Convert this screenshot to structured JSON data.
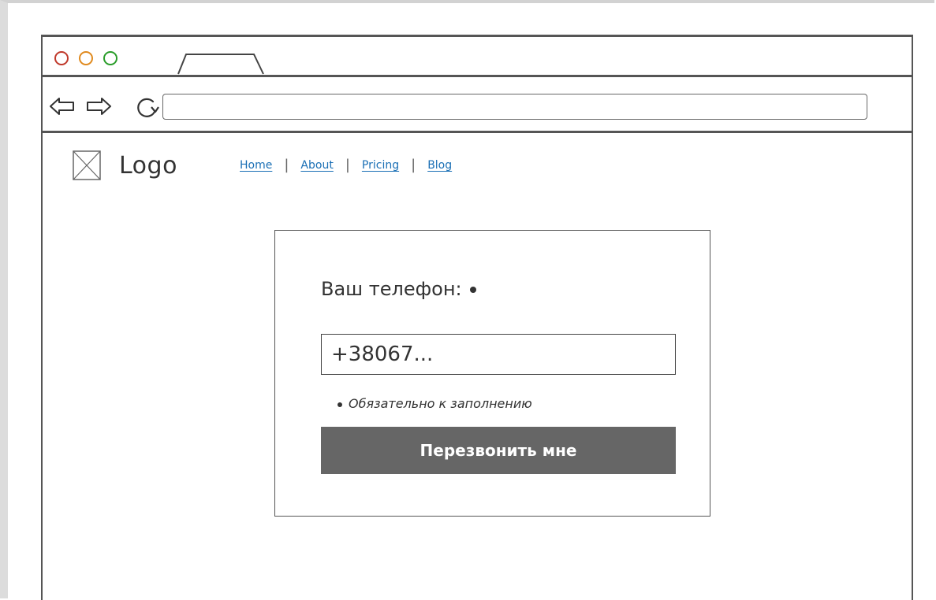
{
  "browser": {
    "address_value": ""
  },
  "header": {
    "logo_text": "Logo",
    "nav": [
      {
        "label": "Home"
      },
      {
        "label": "About"
      },
      {
        "label": "Pricing"
      },
      {
        "label": "Blog"
      }
    ],
    "separator": "|"
  },
  "form": {
    "phone_label": "Ваш телефон:",
    "phone_placeholder": "+38067...",
    "phone_value": "",
    "required_hint": "Обязательно к заполнению",
    "submit_label": "Перезвонить мне"
  },
  "colors": {
    "traffic_red": "#c0392b",
    "traffic_orange": "#e08a1e",
    "traffic_green": "#2a9d2a",
    "link": "#1a6fb5",
    "button_bg": "#666666",
    "button_text": "#ffffff"
  },
  "icons": {
    "back": "arrow-left-icon",
    "forward": "arrow-right-icon",
    "reload": "reload-icon",
    "logo": "image-placeholder-icon"
  }
}
